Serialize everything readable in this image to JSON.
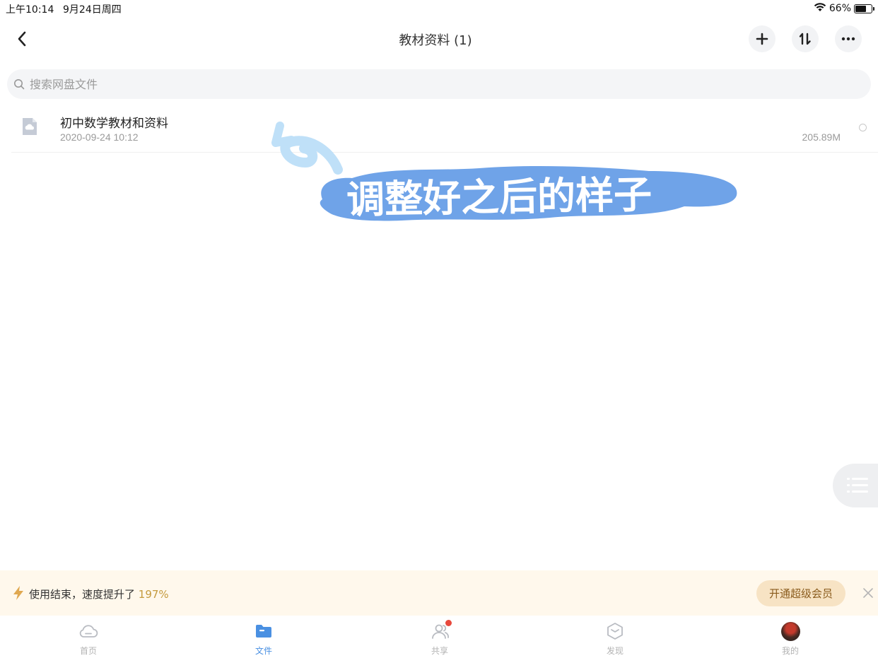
{
  "status_bar": {
    "time": "上午10:14",
    "date": "9月24日周四",
    "battery": "66%",
    "battery_level": 0.66
  },
  "nav": {
    "title": "教材资料 (1)"
  },
  "search": {
    "placeholder": "搜索网盘文件",
    "value": ""
  },
  "files": [
    {
      "name": "初中数学教材和资料",
      "date": "2020-09-24 10:12",
      "size": "205.89M"
    }
  ],
  "overlay": {
    "sticker_text": "调整好之后的样子",
    "sticker_color": "#6fa3e8"
  },
  "promo": {
    "text": "使用结束，速度提升了",
    "percent": "197%",
    "button_label": "开通超级会员"
  },
  "tabs": [
    {
      "label": "首页",
      "icon": "cloud-icon",
      "active": false
    },
    {
      "label": "文件",
      "icon": "folder-icon",
      "active": true
    },
    {
      "label": "共享",
      "icon": "people-icon",
      "active": false,
      "badge": true
    },
    {
      "label": "发现",
      "icon": "cube-icon",
      "active": false
    },
    {
      "label": "我的",
      "icon": "avatar",
      "active": false
    }
  ],
  "colors": {
    "accent": "#4a90e2",
    "promo_background": "#fff8ec",
    "promo_button": "#f7e3c4",
    "badge": "#e8493d"
  }
}
